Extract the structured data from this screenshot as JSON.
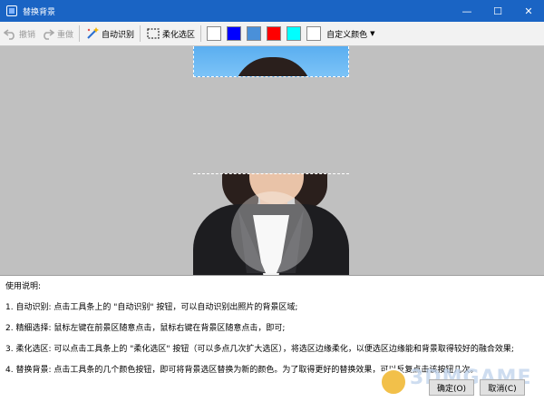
{
  "window": {
    "title": "替换背景",
    "controls": [
      "minimize",
      "maximize",
      "close"
    ]
  },
  "toolbar": {
    "undo_label": "撤销",
    "redo_label": "重做",
    "auto_identify_label": "自动识别",
    "feather_label": "柔化选区",
    "custom_color_label": "自定义颜色",
    "swatches": [
      "#ffffff",
      "#0000ff",
      "#4a90d9",
      "#ff0000",
      "#00ffff",
      "#ffffff"
    ]
  },
  "instructions": {
    "heading": "使用说明:",
    "lines": [
      "1. 自动识别: 点击工具条上的 \"自动识别\" 按钮，可以自动识别出照片的背景区域;",
      "2. 精细选择: 鼠标左键在前景区随意点击，鼠标右键在背景区随意点击，即可;",
      "3. 柔化选区: 可以点击工具条上的 \"柔化选区\" 按钮（可以多点几次扩大选区），将选区边缘柔化，以便选区边缘能和背景取得较好的融合效果;",
      "4. 替换背景: 点击工具条的几个颜色按钮，即可将背景选区替换为新的颜色。为了取得更好的替换效果，可以反复点击该按钮几次。"
    ]
  },
  "buttons": {
    "ok_label": "确定(O)",
    "cancel_label": "取消(C)"
  },
  "watermark": {
    "text": "3DMGAME"
  }
}
